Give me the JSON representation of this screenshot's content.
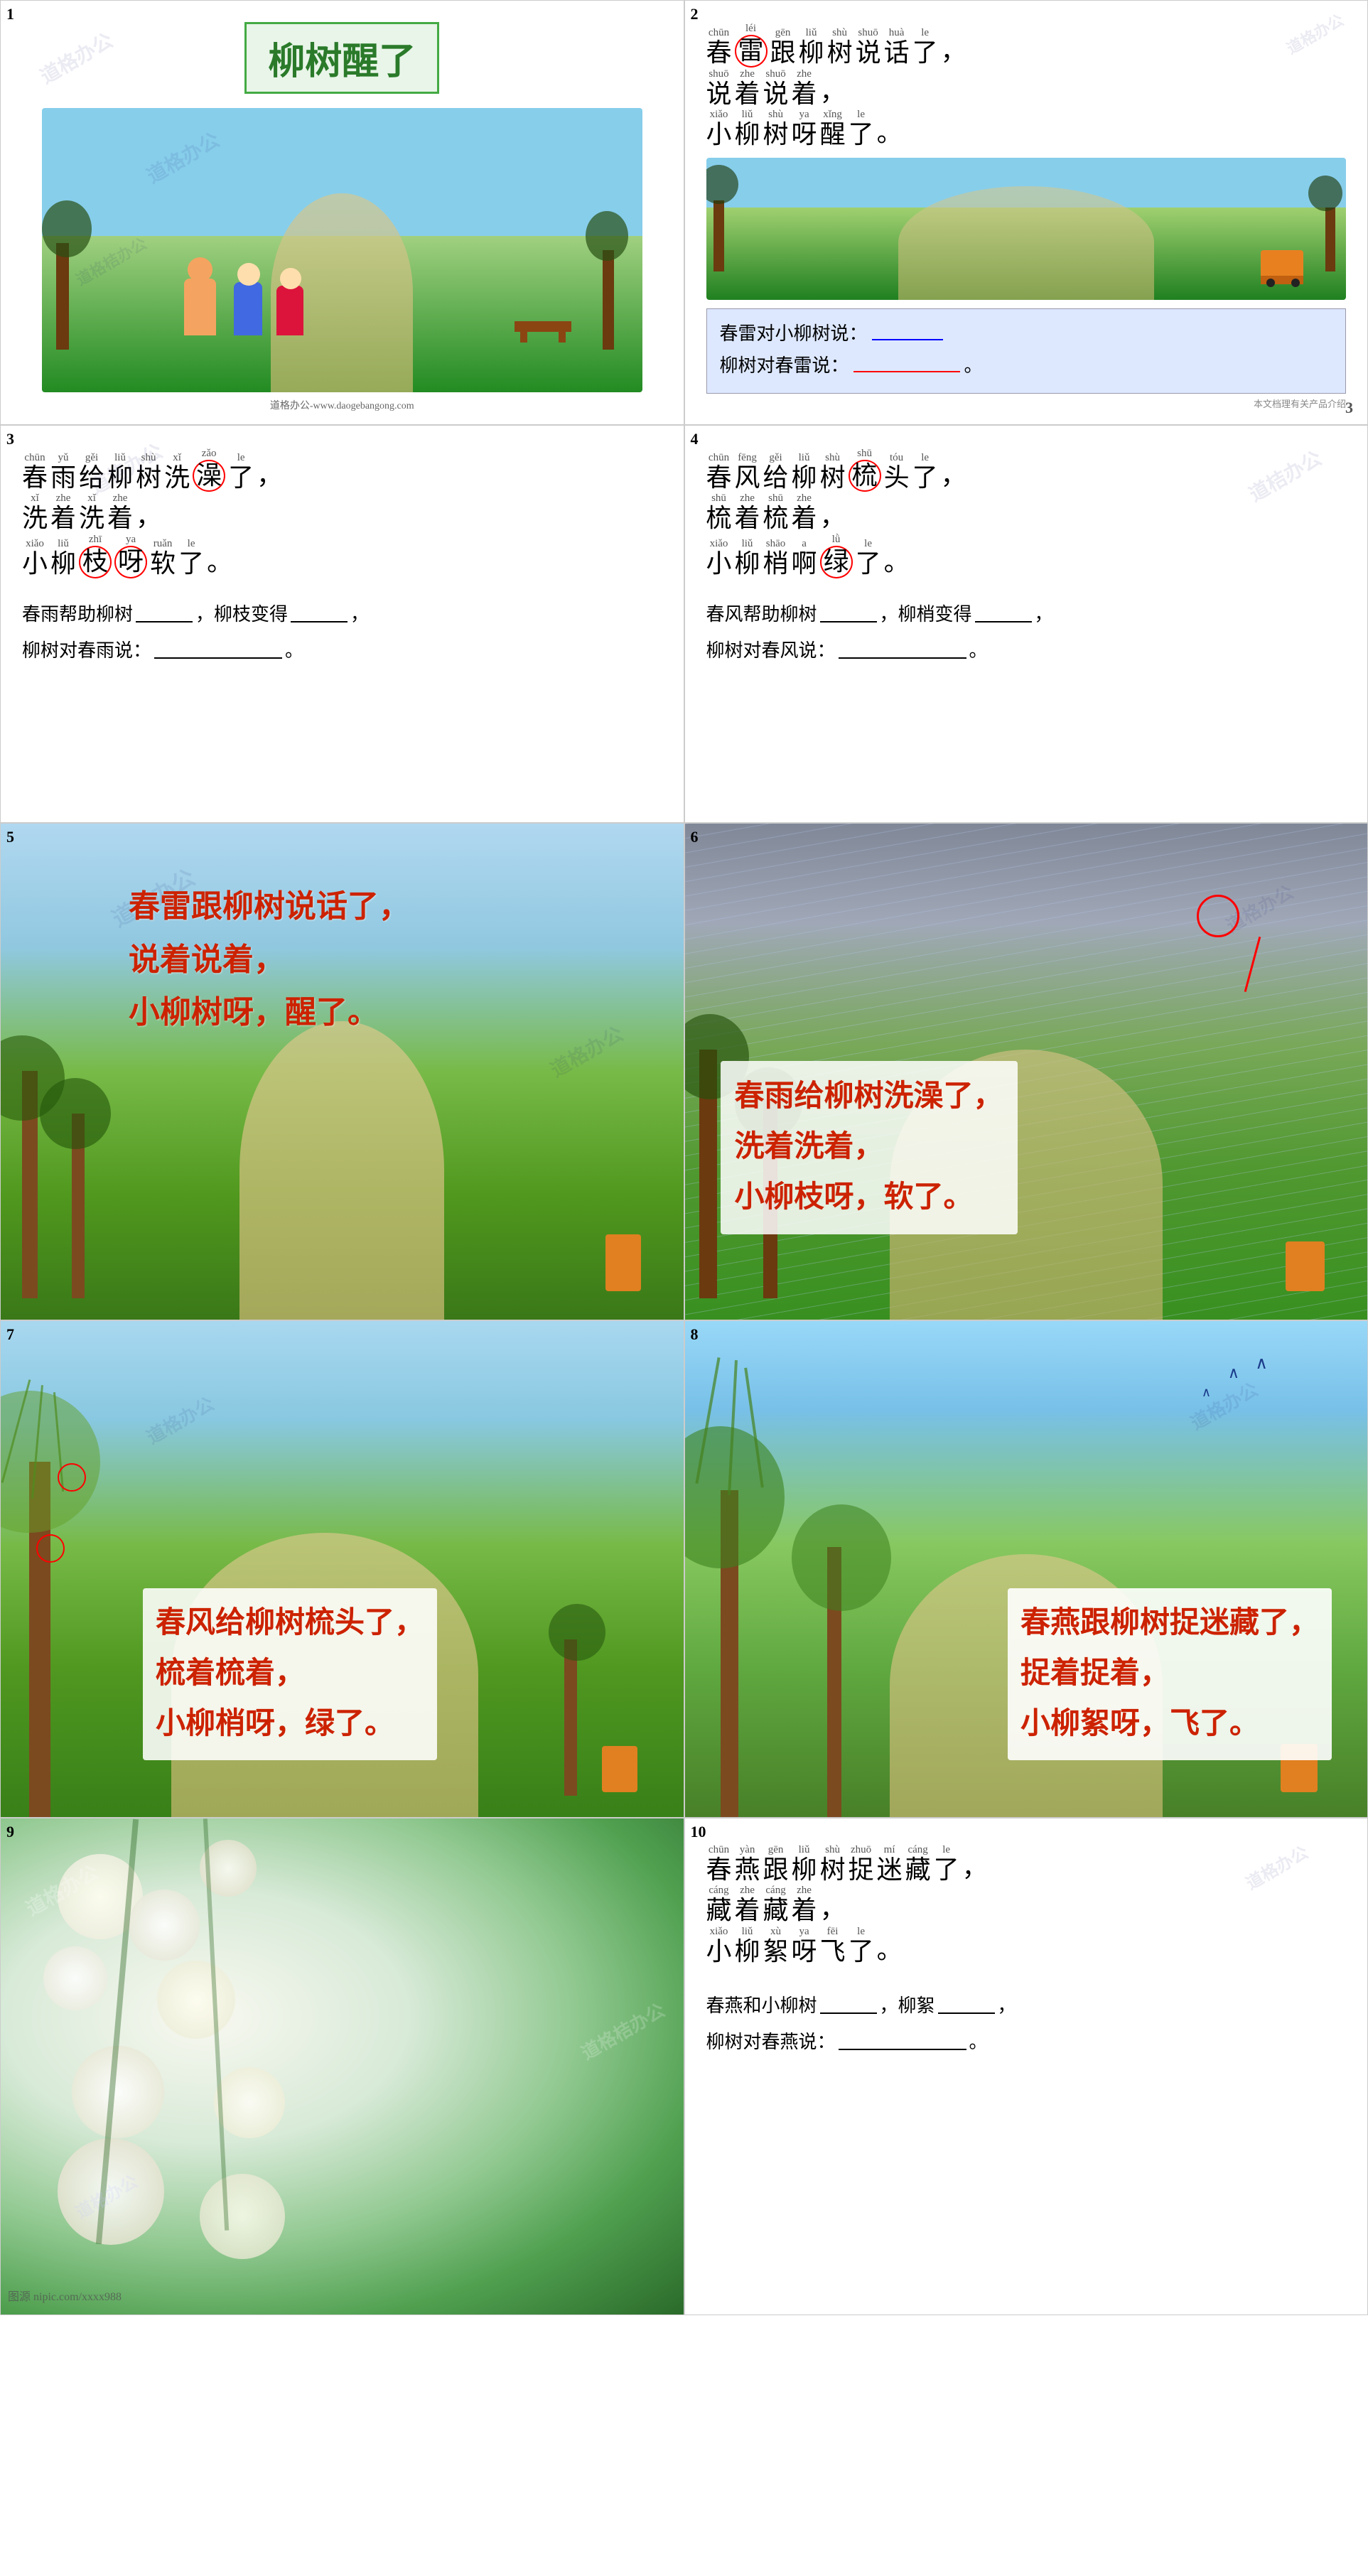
{
  "cells": {
    "cell1": {
      "number": "1",
      "title": "柳树醒了",
      "website": "道格办公-www.daogebangong.com"
    },
    "cell2": {
      "number": "2",
      "lines": [
        {
          "pinyin": [
            "chūn",
            "léi",
            "gēn",
            "liǔ",
            "shù",
            "shuō",
            "huà",
            "le"
          ],
          "chars": [
            "春",
            "雷",
            "跟",
            "柳",
            "树",
            "说",
            "话",
            "了"
          ],
          "circle": [
            1
          ],
          "circle_color": [
            "red"
          ],
          "punctuation": "，"
        },
        {
          "pinyin": [
            "shuō",
            "zhe",
            "shuō",
            "zhe"
          ],
          "chars": [
            "说",
            "着",
            "说",
            "着"
          ],
          "punctuation": "，"
        },
        {
          "pinyin": [
            "xiǎo",
            "liǔ",
            "shù",
            "ya",
            "xǐng",
            "le"
          ],
          "chars": [
            "小",
            "柳",
            "树",
            "呀",
            "醒",
            "了"
          ],
          "punctuation": "。"
        }
      ],
      "fill_label1": "春雷对小柳树说：",
      "fill_label2": "柳树对春雷说："
    },
    "cell3": {
      "number": "3",
      "lines": [
        {
          "pinyin": [
            "chūn",
            "yǔ",
            "gěi",
            "liǔ",
            "shù",
            "xǐ",
            "zǎo",
            "le"
          ],
          "chars": [
            "春",
            "雨",
            "给",
            "柳",
            "树",
            "洗",
            "澡",
            "了"
          ],
          "circle": [
            6
          ],
          "circle_color": [
            "red"
          ],
          "punctuation": "，"
        },
        {
          "pinyin": [
            "xǐ",
            "zhe",
            "xǐ",
            "zhe"
          ],
          "chars": [
            "洗",
            "着",
            "洗",
            "着"
          ],
          "punctuation": "，"
        },
        {
          "pinyin": [
            "xiǎo",
            "liǔ",
            "zhī",
            "ya",
            "ruǎn",
            "le"
          ],
          "chars": [
            "小",
            "柳",
            "枝",
            "呀",
            "软",
            "了"
          ],
          "circle": [
            4,
            5
          ],
          "circle_color": [
            "red",
            "red"
          ],
          "punctuation": "。"
        }
      ],
      "fill1": "春雨帮助柳树",
      "fill2": "，柳枝变得",
      "fill3": "，",
      "fill4": "柳树对春雨说：",
      "fill5": "。"
    },
    "cell4": {
      "number": "4",
      "lines": [
        {
          "pinyin": [
            "chūn",
            "fēng",
            "gěi",
            "liǔ",
            "shù",
            "shū",
            "tóu",
            "le"
          ],
          "chars": [
            "春",
            "风",
            "给",
            "柳",
            "树",
            "梳",
            "头",
            "了"
          ],
          "circle": [
            5
          ],
          "circle_color": [
            "red"
          ],
          "punctuation": "，"
        },
        {
          "pinyin": [
            "shū",
            "zhe",
            "shū",
            "zhe"
          ],
          "chars": [
            "梳",
            "着",
            "梳",
            "着"
          ],
          "punctuation": "，"
        },
        {
          "pinyin": [
            "xiǎo",
            "liǔ",
            "shāo",
            "a",
            "lǜ",
            "le"
          ],
          "chars": [
            "小",
            "柳",
            "梢",
            "啊",
            "绿",
            "了"
          ],
          "circle": [
            2
          ],
          "circle_color": [
            "red"
          ],
          "punctuation": "。"
        }
      ],
      "fill1": "春风帮助柳树",
      "fill2": "，柳梢变得",
      "fill3": "，",
      "fill4": "柳树对春风说：",
      "fill5": "。"
    },
    "cell5": {
      "number": "5",
      "text_lines": [
        "春雷跟柳树说话了，",
        "说着说着，",
        "小柳树呀，醒了。"
      ]
    },
    "cell6": {
      "number": "6",
      "text_lines": [
        "春雨给柳树洗澡了，",
        "洗着洗着，",
        "小柳枝呀，软了。"
      ]
    },
    "cell7": {
      "number": "7",
      "text_lines": [
        "春风给柳树梳头了，",
        "梳着梳着，",
        "小柳梢呀，绿了。"
      ]
    },
    "cell8": {
      "number": "8",
      "text_lines": [
        "春燕跟柳树捉迷藏了，",
        "捉着捉着，",
        "小柳絮呀，飞了。"
      ]
    },
    "cell9": {
      "number": "9",
      "source": "图源 nipic.com/xxxx988"
    },
    "cell10": {
      "number": "10",
      "lines": [
        {
          "pinyin": [
            "chūn",
            "yàn",
            "gēn",
            "liǔ",
            "shù",
            "zhuō",
            "mí",
            "cáng",
            "le"
          ],
          "chars": [
            "春",
            "燕",
            "跟",
            "柳",
            "树",
            "捉",
            "迷",
            "藏",
            "了"
          ],
          "punctuation": "，"
        },
        {
          "pinyin": [
            "cáng",
            "zhe",
            "cáng",
            "zhe"
          ],
          "chars": [
            "藏",
            "着",
            "藏",
            "着"
          ],
          "punctuation": "，"
        },
        {
          "pinyin": [
            "xiǎo",
            "liǔ",
            "xù",
            "ya",
            "fēi",
            "le"
          ],
          "chars": [
            "小",
            "柳",
            "絮",
            "呀",
            "飞",
            "了"
          ],
          "punctuation": "。"
        }
      ],
      "fill1": "春燕和小柳树",
      "fill2": "，柳絮",
      "fill3": "，",
      "fill4": "柳树对春燕说：",
      "fill5": "。"
    }
  },
  "watermarks": [
    "道格办公",
    "道格办公",
    "道桔办公"
  ]
}
